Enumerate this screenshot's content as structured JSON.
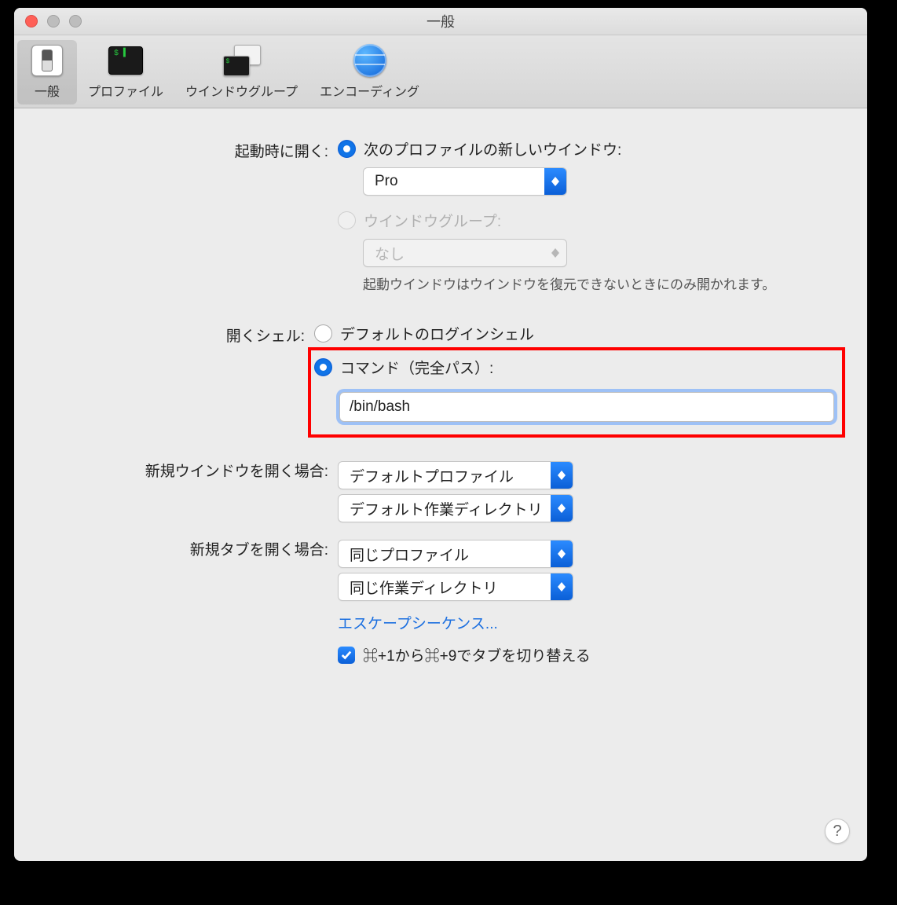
{
  "window": {
    "title": "一般"
  },
  "toolbar": {
    "items": [
      {
        "label": "一般"
      },
      {
        "label": "プロファイル"
      },
      {
        "label": "ウインドウグループ"
      },
      {
        "label": "エンコーディング"
      }
    ]
  },
  "onStartup": {
    "label": "起動時に開く:",
    "optNewWindow": "次のプロファイルの新しいウインドウ:",
    "profileSelected": "Pro",
    "optWindowGroup": "ウインドウグループ:",
    "windowGroupSelected": "なし",
    "hint": "起動ウインドウはウインドウを復元できないときにのみ開かれます。"
  },
  "openShell": {
    "label": "開くシェル:",
    "optDefault": "デフォルトのログインシェル",
    "optCommand": "コマンド（完全パス）:",
    "commandValue": "/bin/bash"
  },
  "newWindow": {
    "label": "新規ウインドウを開く場合:",
    "profile": "デフォルトプロファイル",
    "dir": "デフォルト作業ディレクトリ"
  },
  "newTab": {
    "label": "新規タブを開く場合:",
    "profile": "同じプロファイル",
    "dir": "同じ作業ディレクトリ"
  },
  "escapeLink": "エスケープシーケンス...",
  "switchTabs": "⌘+1から⌘+9でタブを切り替える",
  "helpGlyph": "?"
}
